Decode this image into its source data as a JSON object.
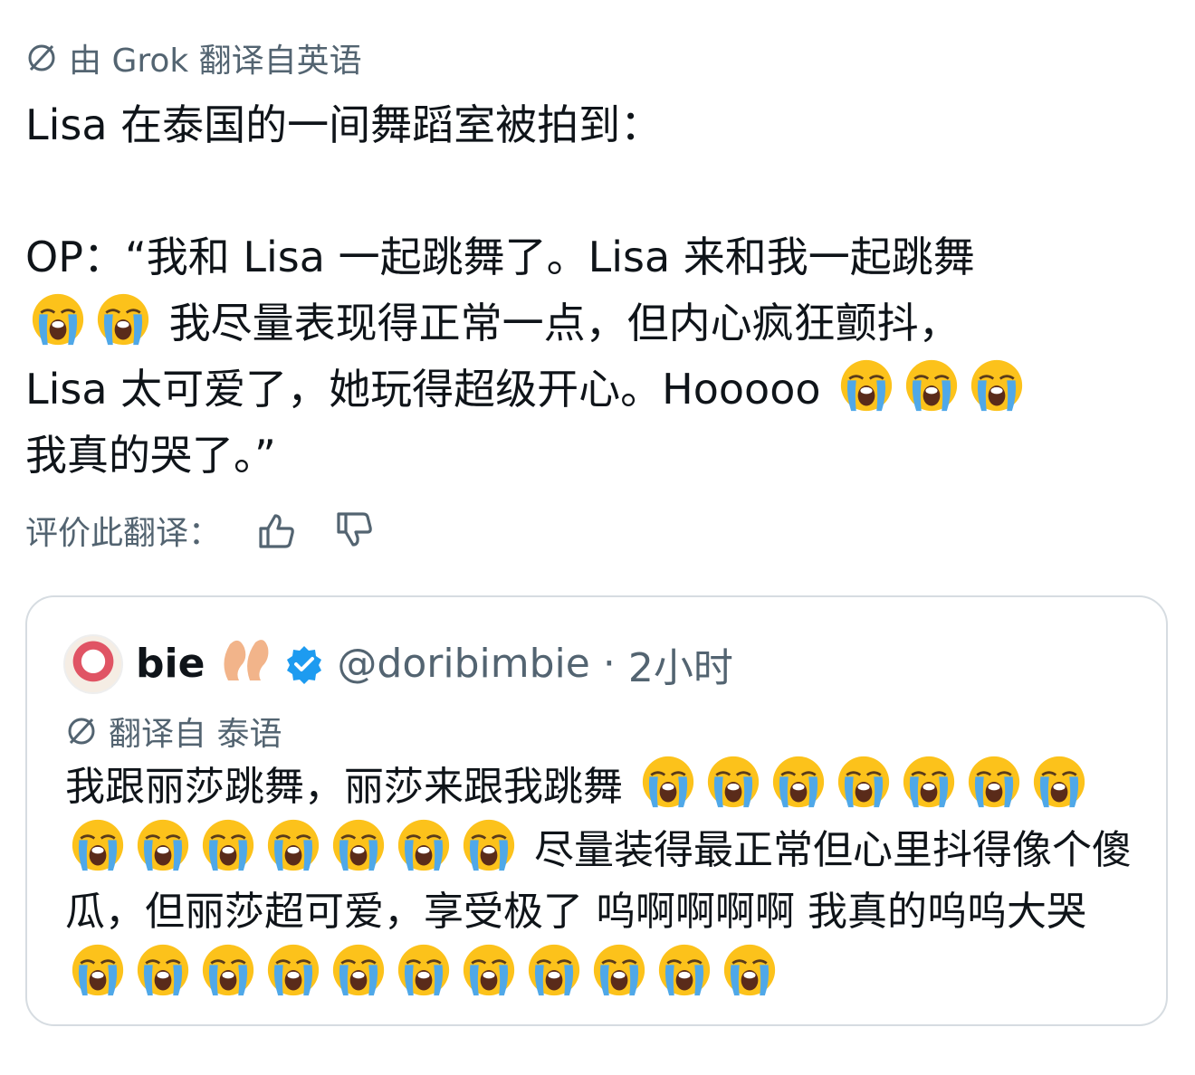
{
  "translation_notice": {
    "icon": "globe-slash-icon",
    "text": "由 Grok 翻译自英语"
  },
  "tweet": {
    "line1": "Lisa 在泰国的一间舞蹈室被拍到：",
    "segments": [
      "OP：“我和 Lisa 一起跳舞了。Lisa 来和我一起跳舞",
      "我尽量表现得正常一点，但内心疯狂颤抖，",
      "Lisa 太可爱了，她玩得超级开心。Hooooo",
      "我真的哭了。”"
    ]
  },
  "rate": {
    "label": "评价此翻译：",
    "like_icon": "thumbs-up-icon",
    "dislike_icon": "thumbs-down-icon"
  },
  "quote": {
    "display_name": "bie",
    "handle": "@doribimbie",
    "separator": "·",
    "time": "2小时",
    "translated_label": "翻译自 泰语",
    "segments": [
      "我跟丽莎跳舞，丽莎来跟我跳舞",
      "尽量装得最正常但心里抖得像个傻瓜，但丽莎超可爱，享受极了 呜啊啊啊啊 我真的呜呜大哭"
    ]
  },
  "colors": {
    "text": "#0f1419",
    "muted": "#536471",
    "verified": "#1d9bf0",
    "border": "#d6dce1",
    "emoji": "#fcc21b"
  },
  "emoji": "crying-face-icon"
}
